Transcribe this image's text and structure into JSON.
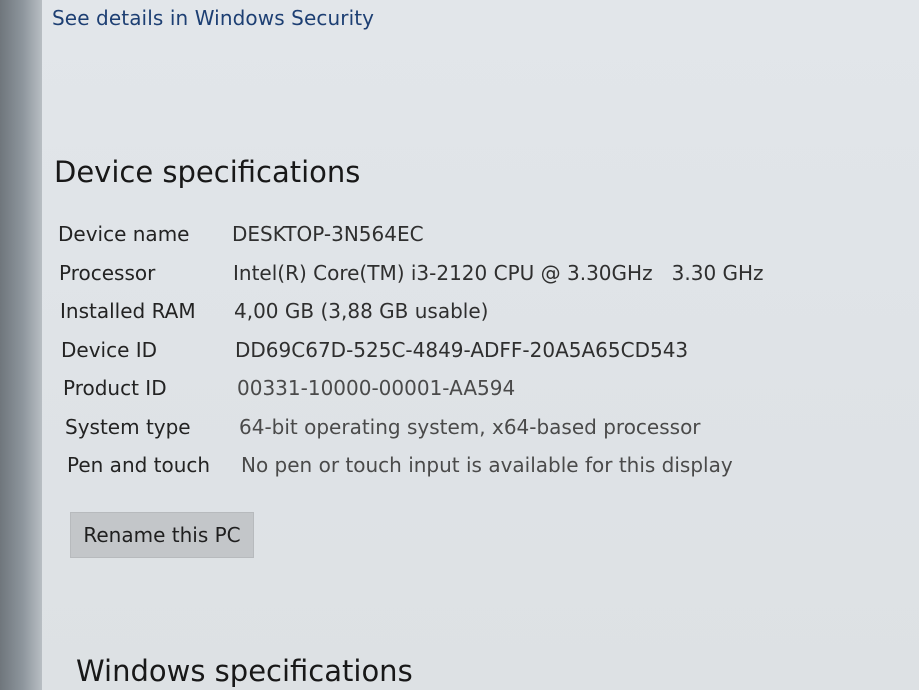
{
  "security_link": "See details in Windows Security",
  "device_specs": {
    "title": "Device specifications",
    "rows": [
      {
        "label": "Device name",
        "value": "DESKTOP-3N564EC"
      },
      {
        "label": "Processor",
        "value": "Intel(R) Core(TM) i3-2120 CPU @ 3.30GHz   3.30 GHz"
      },
      {
        "label": "Installed RAM",
        "value": "4,00 GB (3,88 GB usable)"
      },
      {
        "label": "Device ID",
        "value": "DD69C67D-525C-4849-ADFF-20A5A65CD543"
      },
      {
        "label": "Product ID",
        "value": "00331-10000-00001-AA594"
      },
      {
        "label": "System type",
        "value": "64-bit operating system, x64-based processor"
      },
      {
        "label": "Pen and touch",
        "value": "No pen or touch input is available for this display"
      }
    ],
    "rename_button": "Rename this PC"
  },
  "windows_specs": {
    "title": "Windows specifications"
  }
}
